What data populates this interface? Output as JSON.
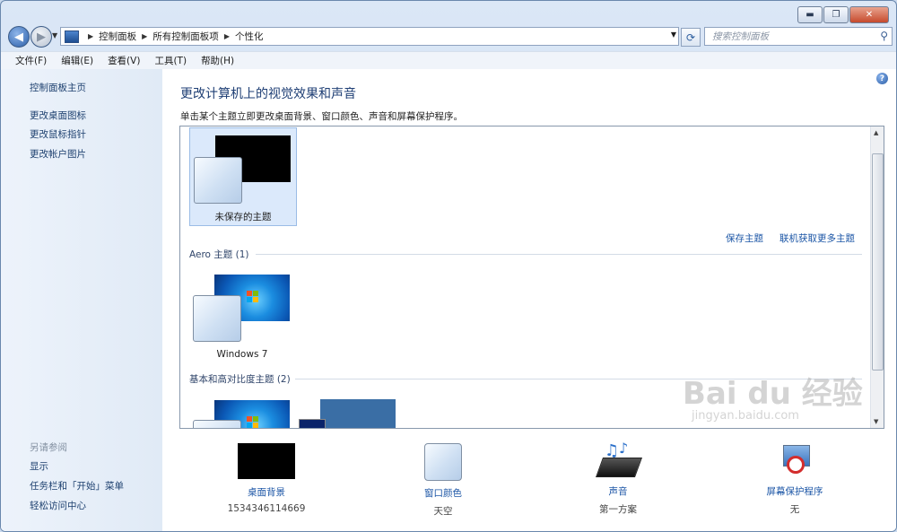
{
  "window": {
    "minimize": "▬",
    "maximize": "❐",
    "close": "✕"
  },
  "address": {
    "crumbs": [
      "控制面板",
      "所有控制面板项",
      "个性化"
    ]
  },
  "search": {
    "placeholder": "搜索控制面板"
  },
  "menu": [
    "文件(F)",
    "编辑(E)",
    "查看(V)",
    "工具(T)",
    "帮助(H)"
  ],
  "sidebar": {
    "home": "控制面板主页",
    "links": [
      "更改桌面图标",
      "更改鼠标指针",
      "更改帐户图片"
    ],
    "see_also": "另请参阅",
    "see_also_links": [
      "显示",
      "任务栏和「开始」菜单",
      "轻松访问中心"
    ]
  },
  "main": {
    "title": "更改计算机上的视觉效果和声音",
    "subtitle": "单击某个主题立即更改桌面背景、窗口颜色、声音和屏幕保护程序。",
    "unsaved_theme": "未保存的主题",
    "save_theme": "保存主题",
    "get_more": "联机获取更多主题",
    "aero_category": "Aero 主题 (1)",
    "win7_theme": "Windows 7",
    "basic_category": "基本和高对比度主题 (2)"
  },
  "bottom": [
    {
      "label": "桌面背景",
      "value": "1534346114669"
    },
    {
      "label": "窗口颜色",
      "value": "天空"
    },
    {
      "label": "声音",
      "value": "第一方案"
    },
    {
      "label": "屏幕保护程序",
      "value": "无"
    }
  ],
  "watermark": {
    "brand": "Bai du 经验",
    "url": "jingyan.baidu.com"
  },
  "colors": {
    "link": "#1c56a6",
    "heading": "#1e3e74",
    "selection": "#dbe9fb"
  }
}
